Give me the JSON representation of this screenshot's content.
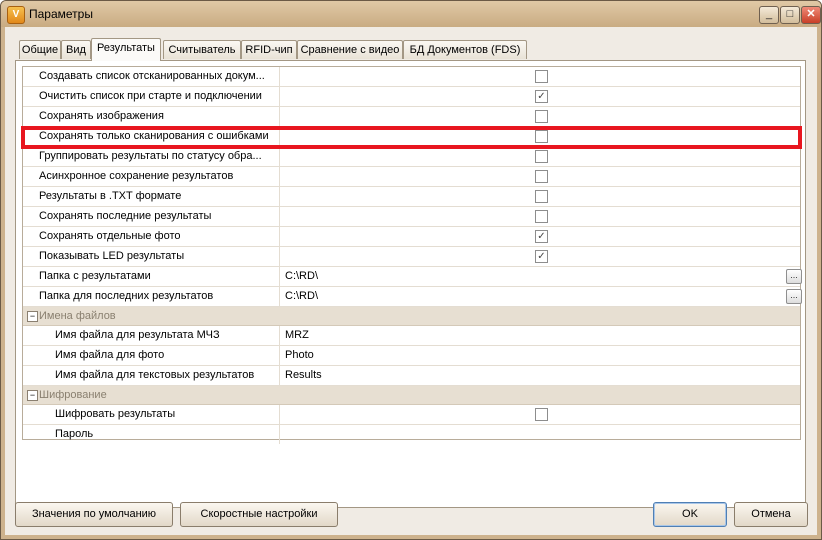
{
  "window": {
    "title": "Параметры",
    "minimize_icon": "minimize-icon",
    "maximize_icon": "maximize-icon",
    "close_icon": "close-icon"
  },
  "tabs": [
    "Общие",
    "Вид",
    "Результаты",
    "Считыватель",
    "RFID-чип",
    "Сравнение с видео",
    "БД Документов (FDS)"
  ],
  "active_tab": "Результаты",
  "rows": [
    {
      "label": "Создавать список отсканированных докум...",
      "checked": false
    },
    {
      "label": "Очистить список при старте и подключении",
      "checked": true
    },
    {
      "label": "Сохранять изображения",
      "checked": false
    },
    {
      "label": "Сохранять только сканирования с ошибками",
      "checked": false
    },
    {
      "label": "Группировать результаты по статусу обра...",
      "checked": false
    },
    {
      "label": "Асинхронное сохранение результатов",
      "checked": false
    },
    {
      "label": "Результаты в .TXT формате",
      "checked": false
    },
    {
      "label": "Сохранять последние результаты",
      "checked": false
    },
    {
      "label": "Сохранять отдельные фото",
      "checked": true
    },
    {
      "label": "Показывать LED результаты",
      "checked": true
    }
  ],
  "folders": [
    {
      "label": "Папка с результатами",
      "value": "C:\\RD\\",
      "button": "..."
    },
    {
      "label": "Папка для последних результатов",
      "value": "C:\\RD\\",
      "button": "..."
    }
  ],
  "categories": {
    "filenames": {
      "title": "Имена файлов",
      "toggle": "−",
      "rows": [
        {
          "label": "Имя файла для результата МЧЗ",
          "value": "MRZ"
        },
        {
          "label": "Имя файла для фото",
          "value": "Photo"
        },
        {
          "label": "Имя файла для текстовых результатов",
          "value": "Results"
        }
      ]
    },
    "encryption": {
      "title": "Шифрование",
      "toggle": "−",
      "rows": [
        {
          "label": "Шифровать результаты",
          "checked": false
        },
        {
          "label": "Пароль",
          "value": ""
        }
      ]
    }
  },
  "buttons": {
    "defaults": "Значения по умолчанию",
    "quick": "Скоростные настройки",
    "ok": "OK",
    "cancel": "Отмена"
  },
  "checkmark": "✓",
  "accent_highlight": "#e8161f"
}
